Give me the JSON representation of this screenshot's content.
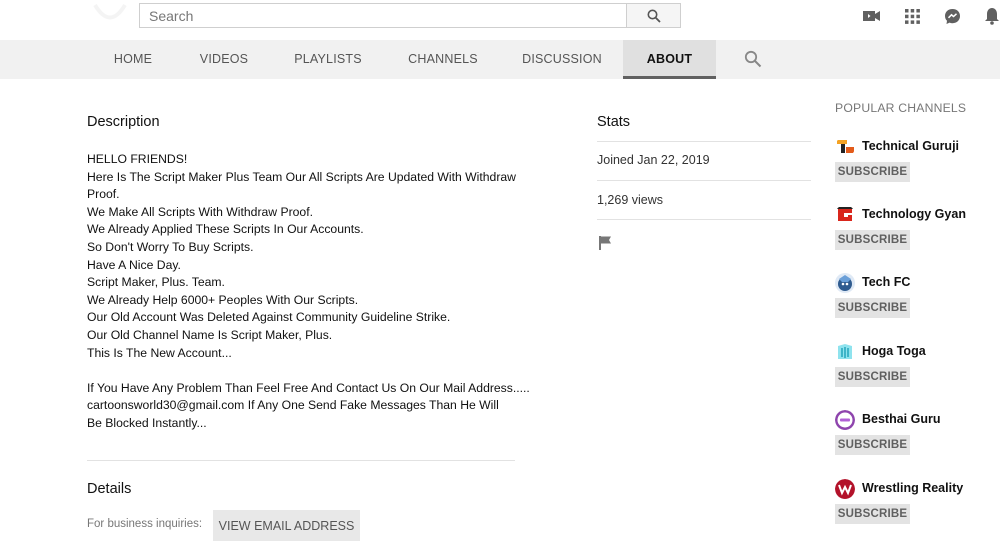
{
  "search": {
    "placeholder": "Search"
  },
  "header_icons": [
    "video-camera-icon",
    "apps-grid-icon",
    "messages-icon",
    "notifications-bell-icon"
  ],
  "tabs": [
    {
      "label": "HOME",
      "active": false
    },
    {
      "label": "VIDEOS",
      "active": false
    },
    {
      "label": "PLAYLISTS",
      "active": false
    },
    {
      "label": "CHANNELS",
      "active": false
    },
    {
      "label": "DISCUSSION",
      "active": false
    },
    {
      "label": "ABOUT",
      "active": true
    }
  ],
  "description": {
    "title": "Description",
    "lines": [
      "HELLO FRIENDS!",
      "Here Is The Script Maker Plus Team Our All Scripts Are Updated With Withdraw Proof.",
      "We Make All Scripts With Withdraw Proof.",
      "We Already Applied These Scripts In Our Accounts.",
      "So Don't Worry To Buy Scripts.",
      "Have A Nice Day.",
      "Script Maker, Plus. Team.",
      "We Already Help 6000+  Peoples With Our Scripts.",
      "Our Old Account Was Deleted Against Community Guideline Strike.",
      "Our Old Channel Name Is Script Maker, Plus.",
      "This Is The New Account...",
      "",
      "If You Have Any Problem Than Feel Free And Contact Us On Our Mail Address.....",
      "cartoonsworld30@gmail.com If Any One Send Fake Messages Than He Will Be Blocked Instantly..."
    ]
  },
  "details": {
    "title": "Details",
    "business_label": "For business inquiries:",
    "email_button": "VIEW EMAIL ADDRESS"
  },
  "stats": {
    "title": "Stats",
    "joined": "Joined Jan 22, 2019",
    "views": "1,269 views"
  },
  "popular_channels": {
    "title": "POPULAR CHANNELS",
    "subscribe_label": "SUBSCRIBE",
    "items": [
      {
        "name": "Technical Guruji",
        "avatar_color": "#f4a223"
      },
      {
        "name": "Technology Gyan",
        "avatar_color": "#d9261c"
      },
      {
        "name": "Tech FC",
        "avatar_color": "#3a7bd5"
      },
      {
        "name": "Hoga Toga",
        "avatar_color": "#3ec7d8"
      },
      {
        "name": "Besthai Guru",
        "avatar_color": "#8e44ad"
      },
      {
        "name": "Wrestling Reality",
        "avatar_color": "#b3122a"
      }
    ]
  }
}
